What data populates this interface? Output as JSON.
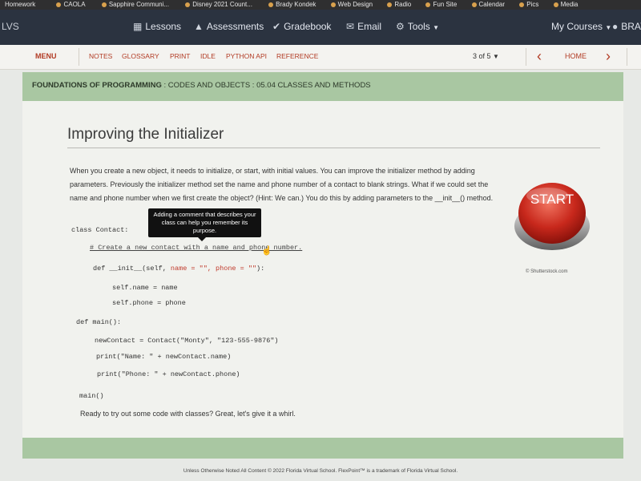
{
  "bookmarks": [
    "Homework",
    "CAOLA",
    "Sapphire Communi...",
    "Disney 2021 Count...",
    "Brady Kondek",
    "Web Design",
    "Radio",
    "Fun Site",
    "Calendar",
    "Pics",
    "Media"
  ],
  "nav": {
    "brand": "LVS",
    "lessons": "Lessons",
    "assessments": "Assessments",
    "gradebook": "Gradebook",
    "email": "Email",
    "tools": "Tools",
    "my_courses": "My Courses",
    "user": "BRAY"
  },
  "toolbar": {
    "menu": "MENU",
    "links": [
      "NOTES",
      "GLOSSARY",
      "PRINT",
      "IDLE",
      "PYTHON API",
      "REFERENCE"
    ],
    "page": "3 of 5",
    "home": "HOME"
  },
  "breadcrumb": {
    "course": "FOUNDATIONS OF PROGRAMMING",
    "path": " : CODES AND OBJECTS : 05.04 CLASSES AND METHODS"
  },
  "lesson": {
    "title": "Improving the Initializer",
    "intro": "When you create a new object, it needs to initialize, or start, with initial values. You can improve the initializer method by adding parameters. Previously the initializer method set the name and phone number of a contact to blank strings. What if we could set the name and phone number when we first create the object? (Hint: We can.) You do this by adding parameters to the __init__() method.",
    "code": {
      "l1": "class Contact:",
      "l2": "# Create a new contact with a name and phone number.",
      "l3a": "def __init__(self, ",
      "l3b": "name = \"\", phone = \"\"",
      "l3c": "):",
      "l4": "self.name = name",
      "l5": "self.phone = phone",
      "l6": "def main():",
      "l7": "newContact = Contact(\"Monty\", \"123-555-9876\")",
      "l8": "print(\"Name: \" + newContact.name)",
      "l9": "print(\"Phone: \" + newContact.phone)",
      "l10": "main()"
    },
    "tooltip": "Adding a comment that describes your class can help you remember its purpose.",
    "image_label": "START",
    "image_credit": "© Shutterstock.com",
    "outro": "Ready to try out some code with classes? Great, let's give it a whirl."
  },
  "footer": "Unless Otherwise Noted All Content © 2022 Florida Virtual School. FlexPoint™ is a trademark of Florida Virtual School.",
  "colors": {
    "accent": "#b23b24",
    "band": "#a9c7a2",
    "nav": "#2b3340"
  }
}
